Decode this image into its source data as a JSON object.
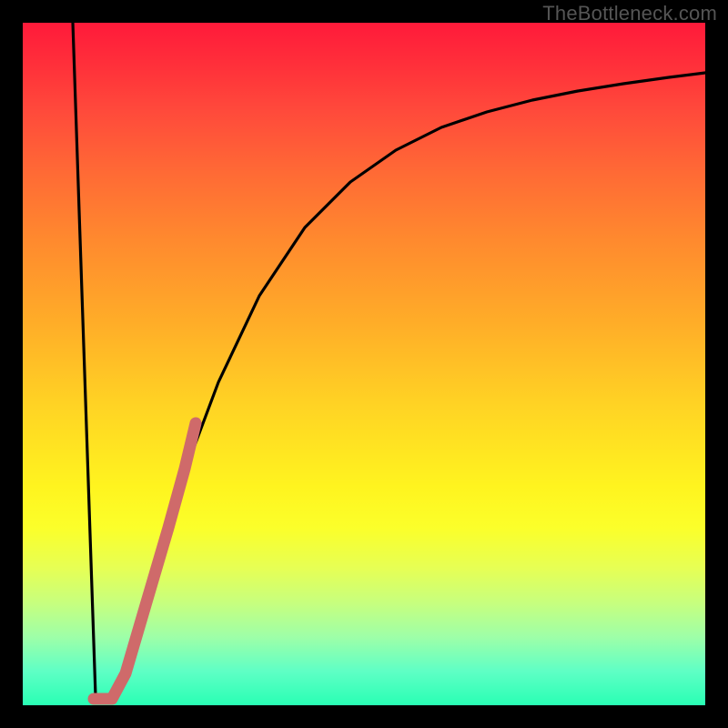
{
  "watermark": "TheBottleneck.com",
  "colors": {
    "background": "#000000",
    "curve": "#000000",
    "highlight": "#cf6a6a"
  },
  "chart_data": {
    "type": "line",
    "title": "",
    "xlabel": "",
    "ylabel": "",
    "xlim": [
      0,
      100
    ],
    "ylim": [
      0,
      100
    ],
    "grid": false,
    "legend": false,
    "annotations": [],
    "series": [
      {
        "name": "bottleneck-curve",
        "x": [
          0,
          2,
          4,
          6,
          8,
          10,
          11,
          12,
          14,
          16,
          18,
          20,
          22,
          25,
          30,
          35,
          40,
          45,
          50,
          55,
          60,
          65,
          70,
          75,
          80,
          85,
          90,
          95,
          100
        ],
        "y": [
          100,
          82,
          64,
          46,
          28,
          10,
          1,
          1.5,
          8,
          18,
          28,
          37,
          45,
          54,
          64,
          71,
          76,
          80,
          83,
          85.5,
          87.5,
          89,
          90,
          91,
          91.8,
          92.5,
          93,
          93.5,
          94
        ]
      },
      {
        "name": "highlight-segment",
        "x": [
          10.5,
          11.5,
          13.5,
          16,
          18.5,
          21,
          23
        ],
        "y": [
          1,
          1,
          6,
          16,
          27,
          37.5,
          46
        ]
      }
    ]
  }
}
